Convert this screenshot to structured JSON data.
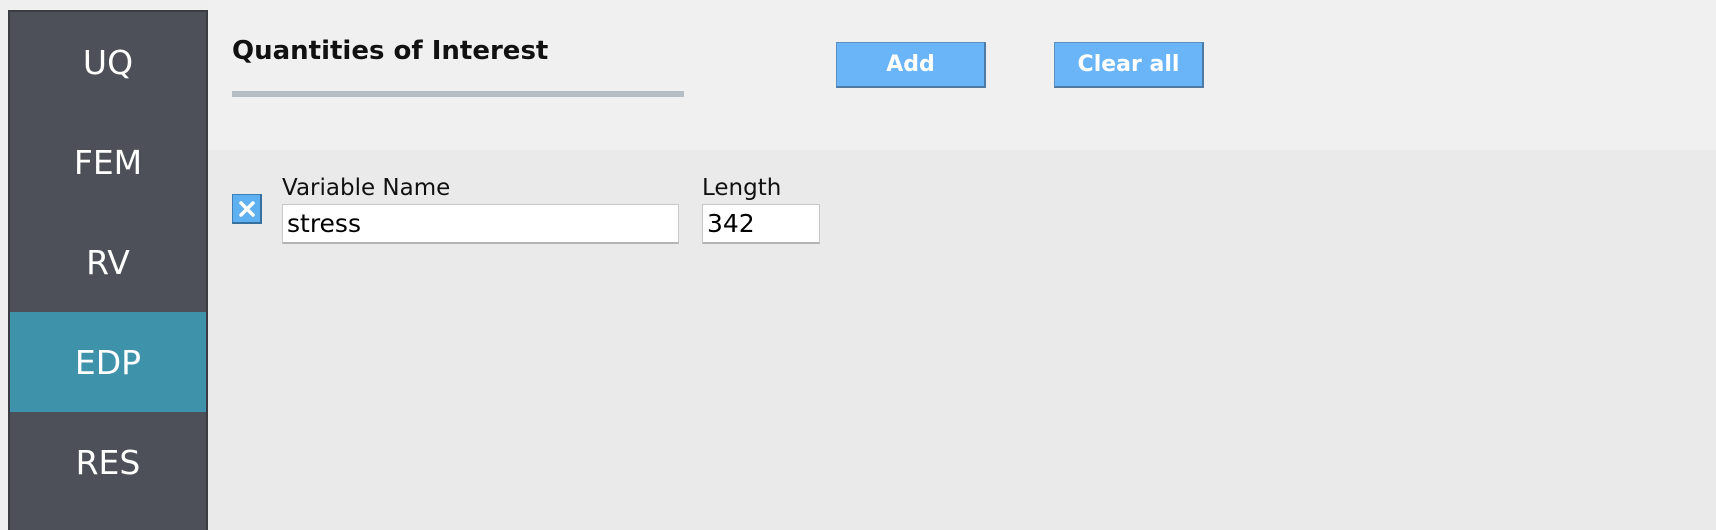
{
  "sidebar": {
    "items": [
      {
        "label": "UQ",
        "active": false
      },
      {
        "label": "FEM",
        "active": false
      },
      {
        "label": "RV",
        "active": false
      },
      {
        "label": "EDP",
        "active": true
      },
      {
        "label": "RES",
        "active": false
      }
    ]
  },
  "header": {
    "title": "Quantities of Interest",
    "add_label": "Add",
    "clear_label": "Clear all"
  },
  "quantities": [
    {
      "name_label": "Variable Name",
      "name_value": "stress",
      "length_label": "Length",
      "length_value": "342"
    }
  ],
  "colors": {
    "sidebar_bg": "#4d5058",
    "active_item": "#3e93aa",
    "button": "#69b5f7"
  },
  "icons": {
    "remove": "close-icon"
  }
}
